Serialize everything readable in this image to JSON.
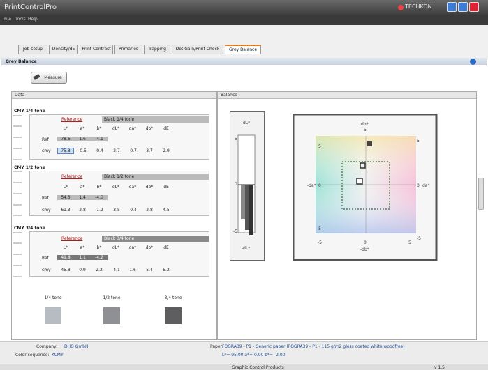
{
  "app": {
    "title": "PrintControlPro",
    "brand": "TECHKON"
  },
  "menu": [
    "File",
    "Tools",
    "Help"
  ],
  "tabs": [
    {
      "label": "Job setup"
    },
    {
      "label": "Density/dE"
    },
    {
      "label": "Print Contrast"
    },
    {
      "label": "Primaries"
    },
    {
      "label": "Trapping"
    },
    {
      "label": "Dot Gain/Print Check"
    },
    {
      "label": "Grey Balance",
      "active": true
    }
  ],
  "section": {
    "title": "Grey Balance"
  },
  "measure_label": "Measure",
  "data_panel": {
    "title": "Data"
  },
  "balance_panel": {
    "title": "Balance"
  },
  "columns": [
    "L*",
    "a*",
    "b*",
    "dL*",
    "da*",
    "db*",
    "dE"
  ],
  "groups": [
    {
      "title": "CMY 1/4 tone",
      "reference_label": "Reference",
      "reference_value": "Black 1/4 tone",
      "ref": [
        "78.6",
        "1.6",
        "-4.1",
        "",
        "",
        "",
        ""
      ],
      "cmy": [
        "75.8",
        "-0.5",
        "-0.4",
        "-2.7",
        "-0.7",
        "3.7",
        "2.9"
      ]
    },
    {
      "title": "CMY 1/2 tone",
      "reference_label": "Reference",
      "reference_value": "Black 1/2 tone",
      "ref": [
        "54.3",
        "1.4",
        "-4.0",
        "",
        "",
        "",
        ""
      ],
      "cmy": [
        "61.3",
        "2.8",
        "-1.2",
        "-3.5",
        "-0.4",
        "2.8",
        "4.5"
      ]
    },
    {
      "title": "CMY 3/4 tone",
      "reference_label": "Reference",
      "reference_value": "Black 3/4 tone",
      "ref": [
        "49.8",
        "1.1",
        "-4.2",
        "",
        "",
        "",
        ""
      ],
      "cmy": [
        "45.8",
        "0.9",
        "2.2",
        "-4.1",
        "1.6",
        "5.4",
        "5.2"
      ]
    }
  ],
  "row_labels": {
    "ref": "Ref",
    "cmy": "cmy"
  },
  "swatches": [
    {
      "label": "1/4 tone",
      "color": "#b7bcc2"
    },
    {
      "label": "1/2 tone",
      "color": "#8e9094"
    },
    {
      "label": "3/4 tone",
      "color": "#5e5e60"
    }
  ],
  "balance_chart": {
    "bar_top_label": "dL*",
    "bar_bottom_label": "-dL*",
    "bar_scale": [
      "5",
      "0",
      "-5"
    ],
    "top_label": "db*",
    "bottom_label": "-db*",
    "left_label": "-da*",
    "right_label": "da*",
    "ticks_top": [
      "5"
    ],
    "ticks_bottom": [
      "-5",
      "0",
      "5"
    ],
    "left_ticks": [
      "5",
      "0",
      "-5"
    ],
    "right_ticks": [
      "5",
      "0",
      "-5"
    ],
    "center": "0"
  },
  "status": {
    "company_label": "Company:",
    "company_value": "DHG GmbH",
    "sequence_label": "Color sequence:",
    "sequence_value": "KCMY",
    "paper_label": "Paper:",
    "paper_value": "FOGRA39 - P1 - Generic paper (FOGRA39 - P1 - 115 g/m2 gloss coated white woodfree)",
    "paper_lab": "L*= 95.00   a*= 0.00   b*= -2.00",
    "footer": "Graphic Control Products",
    "version": "v 1.5"
  }
}
